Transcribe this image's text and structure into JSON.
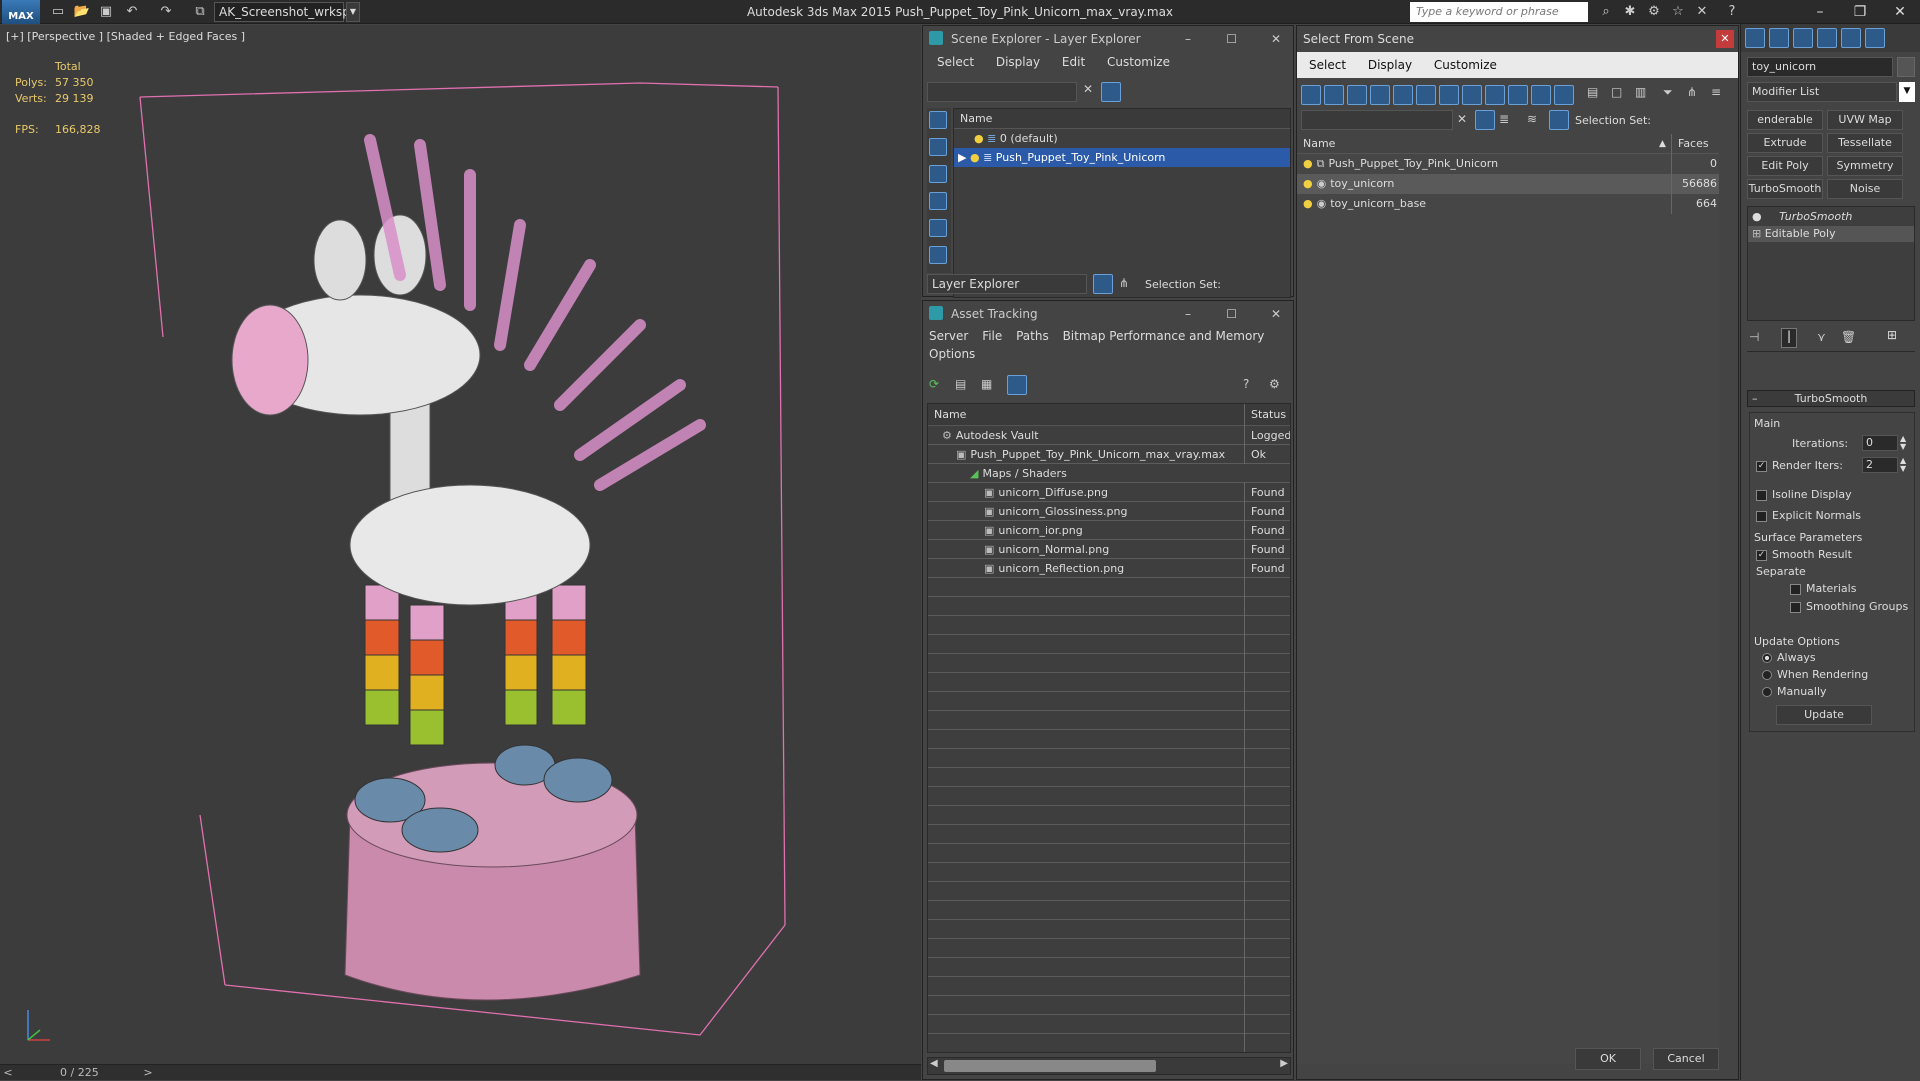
{
  "app": {
    "title": "Autodesk 3ds Max  2015    Push_Puppet_Toy_Pink_Unicorn_max_vray.max",
    "logo": "MAX",
    "workspace": "AK_Screenshot_wrksp",
    "search_placeholder": "Type a keyword or phrase"
  },
  "viewport": {
    "label": "[+] [Perspective ] [Shaded + Edged Faces ]",
    "stats": {
      "total_label": "Total",
      "polys_label": "Polys:",
      "polys_value": "57 350",
      "verts_label": "Verts:",
      "verts_value": "29 139",
      "fps_label": "FPS:",
      "fps_value": "166,828"
    },
    "timeline": "0 / 225"
  },
  "scene_explorer": {
    "title": "Scene Explorer - Layer Explorer",
    "menus": [
      "Select",
      "Display",
      "Edit",
      "Customize"
    ],
    "column_name": "Name",
    "rows": [
      "0 (default)",
      "Push_Puppet_Toy_Pink_Unicorn"
    ],
    "footer_dropdown": "Layer Explorer",
    "selection_set_label": "Selection Set:"
  },
  "asset_tracking": {
    "title": "Asset Tracking",
    "menus": [
      "Server",
      "File",
      "Paths",
      "Bitmap Performance and Memory"
    ],
    "menu_options": "Options",
    "col_name": "Name",
    "col_status": "Status",
    "rows": [
      {
        "name": "Autodesk Vault",
        "status": "Logged",
        "indent": 0
      },
      {
        "name": "Push_Puppet_Toy_Pink_Unicorn_max_vray.max",
        "status": "Ok",
        "indent": 1
      },
      {
        "name": "Maps / Shaders",
        "status": "",
        "indent": 2
      },
      {
        "name": "unicorn_Diffuse.png",
        "status": "Found",
        "indent": 3
      },
      {
        "name": "unicorn_Glossiness.png",
        "status": "Found",
        "indent": 3
      },
      {
        "name": "unicorn_ior.png",
        "status": "Found",
        "indent": 3
      },
      {
        "name": "unicorn_Normal.png",
        "status": "Found",
        "indent": 3
      },
      {
        "name": "unicorn_Reflection.png",
        "status": "Found",
        "indent": 3
      }
    ]
  },
  "select_from_scene": {
    "title": "Select From Scene",
    "menus": [
      "Select",
      "Display",
      "Customize"
    ],
    "selection_set_label": "Selection Set:",
    "col_name": "Name",
    "col_faces": "Faces",
    "rows": [
      {
        "name": "Push_Puppet_Toy_Pink_Unicorn",
        "faces": "0"
      },
      {
        "name": "toy_unicorn",
        "faces": "56686"
      },
      {
        "name": "toy_unicorn_base",
        "faces": "664"
      }
    ],
    "ok": "OK",
    "cancel": "Cancel"
  },
  "command_panel": {
    "object_name": "toy_unicorn",
    "modifier_list": "Modifier List",
    "buttons": [
      "enderable Spli",
      "UVW Map",
      "Extrude",
      "Tessellate",
      "Edit Poly",
      "Symmetry",
      "TurboSmooth",
      "Noise"
    ],
    "stack": [
      "TurboSmooth",
      "Editable Poly"
    ],
    "rollout_title": "TurboSmooth",
    "main_label": "Main",
    "iterations_label": "Iterations:",
    "iterations_value": "0",
    "render_iters_label": "Render Iters:",
    "render_iters_value": "2",
    "isoline_label": "Isoline Display",
    "explicit_normals_label": "Explicit Normals",
    "surface_params_label": "Surface Parameters",
    "smooth_result_label": "Smooth Result",
    "separate_label": "Separate",
    "materials_label": "Materials",
    "smoothing_groups_label": "Smoothing Groups",
    "update_options_label": "Update Options",
    "always_label": "Always",
    "when_rendering_label": "When Rendering",
    "manually_label": "Manually",
    "update_button": "Update"
  },
  "colors": {
    "selection_blue": "#2a5aa8",
    "wireframe_pink": "#e070b0",
    "stat_yellow": "#e8c96a"
  }
}
